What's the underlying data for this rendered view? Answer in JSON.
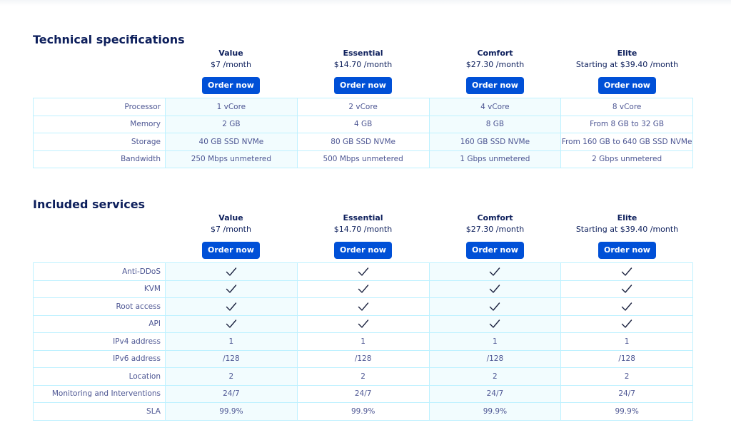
{
  "plans": [
    {
      "name": "Value",
      "price": "$7 /month",
      "order": "Order now"
    },
    {
      "name": "Essential",
      "price": "$14.70 /month",
      "order": "Order now"
    },
    {
      "name": "Comfort",
      "price": "$27.30 /month",
      "order": "Order now"
    },
    {
      "name": "Elite",
      "price": "Starting at $39.40 /month",
      "order": "Order now"
    }
  ],
  "tech": {
    "title": "Technical specifications",
    "rows": [
      {
        "label": "Processor",
        "values": [
          "1 vCore",
          "2 vCore",
          "4 vCore",
          "8 vCore"
        ]
      },
      {
        "label": "Memory",
        "values": [
          "2 GB",
          "4 GB",
          "8 GB",
          "From 8 GB to 32 GB"
        ]
      },
      {
        "label": "Storage",
        "values": [
          "40 GB SSD NVMe",
          "80 GB SSD NVMe",
          "160 GB SSD NVMe",
          "From 160 GB to 640 GB SSD NVMe"
        ]
      },
      {
        "label": "Bandwidth",
        "values": [
          "250 Mbps unmetered",
          "500 Mbps unmetered",
          "1 Gbps unmetered",
          "2 Gbps unmetered"
        ]
      }
    ]
  },
  "services": {
    "title": "Included services",
    "rows": [
      {
        "label": "Anti-DDoS",
        "check": true
      },
      {
        "label": "KVM",
        "check": true
      },
      {
        "label": "Root access",
        "check": true
      },
      {
        "label": "API",
        "check": true
      },
      {
        "label": "IPv4 address",
        "values": [
          "1",
          "1",
          "1",
          "1"
        ]
      },
      {
        "label": "IPv6 address",
        "values": [
          "/128",
          "/128",
          "/128",
          "/128"
        ]
      },
      {
        "label": "Location",
        "values": [
          "2",
          "2",
          "2",
          "2"
        ]
      },
      {
        "label": "Monitoring and Interventions",
        "values": [
          "24/7",
          "24/7",
          "24/7",
          "24/7"
        ]
      },
      {
        "label": "SLA",
        "values": [
          "99.9%",
          "99.9%",
          "99.9%",
          "99.9%"
        ]
      }
    ]
  },
  "icons": {
    "check": "checkmark-icon"
  },
  "colors": {
    "accent": "#0050d7",
    "heading": "#0c1e5b",
    "text": "#4d5693",
    "border": "#bef1ff",
    "alt_bg": "#f2fcfe"
  }
}
